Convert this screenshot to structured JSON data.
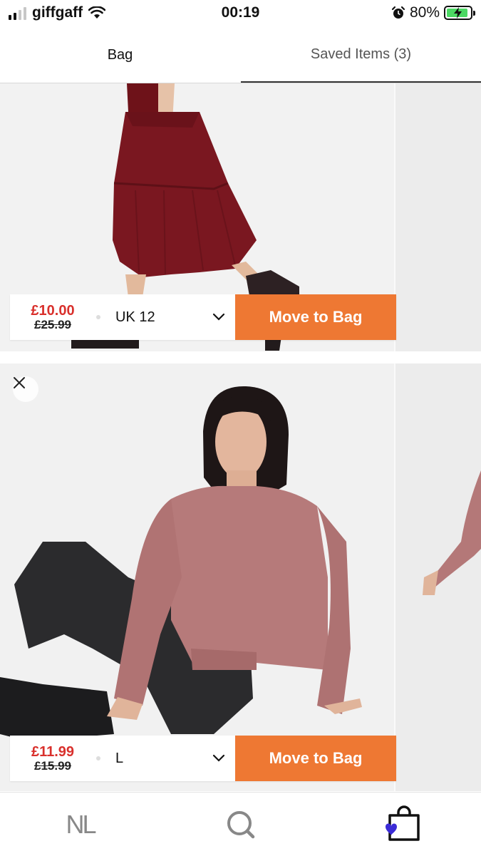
{
  "status_bar": {
    "carrier": "giffgaff",
    "time": "00:19",
    "battery": "80%",
    "icons": [
      "signal-icon",
      "wifi-icon",
      "alarm-icon",
      "battery-charging-icon"
    ]
  },
  "tabs": [
    {
      "label": "Bag"
    },
    {
      "label": "Saved Items (3)"
    }
  ],
  "items": [
    {
      "product": "dress-photo",
      "price": "£10.00",
      "was_price": "£25.99",
      "size": "UK 12",
      "action": "Move to Bag"
    },
    {
      "product": "jumper-photo",
      "price": "£11.99",
      "was_price": "£15.99",
      "size": "L",
      "action": "Move to Bag"
    }
  ],
  "nav": {
    "logo": "NL",
    "icons": [
      "home-logo-icon",
      "search-icon",
      "bag-icon"
    ]
  },
  "colors": {
    "accent": "#ee7833",
    "sale_price": "#d9302c",
    "bag_badge": "#3b2bd6"
  }
}
